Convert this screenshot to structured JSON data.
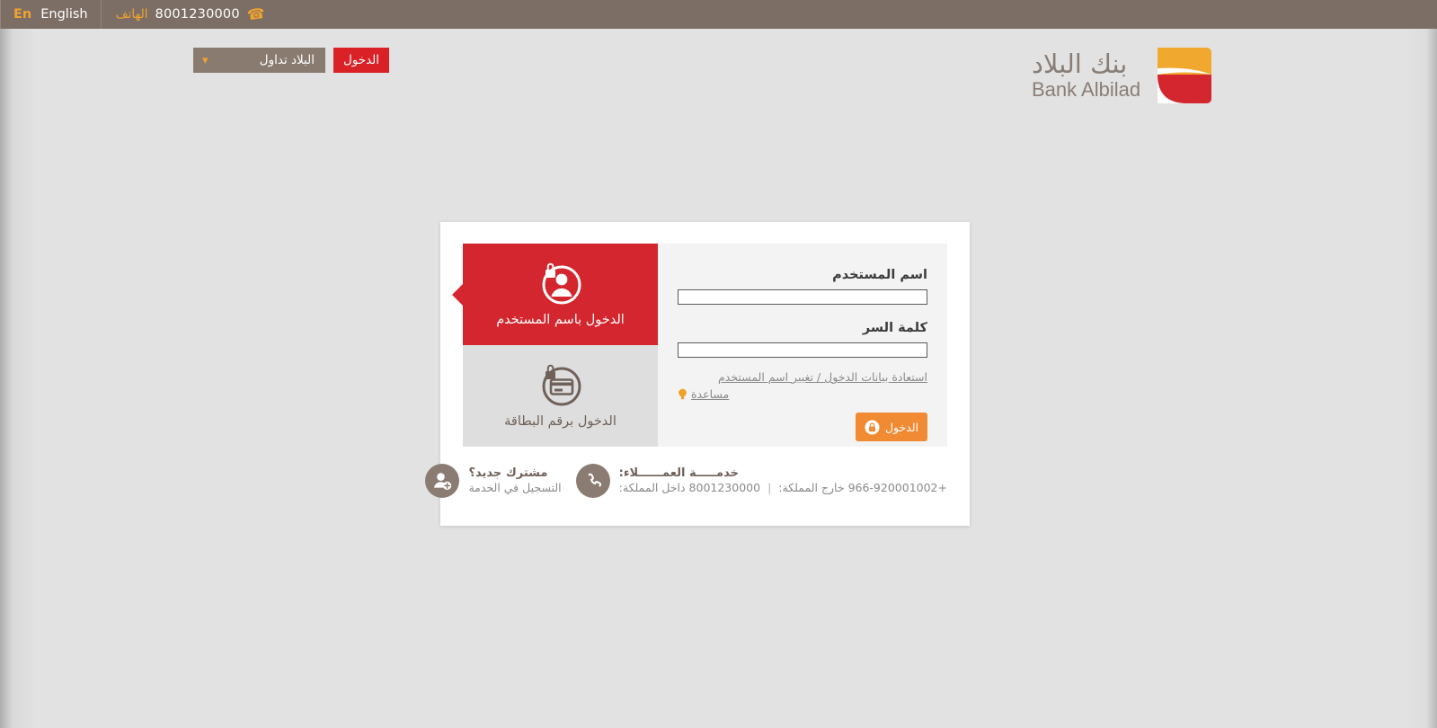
{
  "topbar": {
    "phone_icon": "phone-icon",
    "phone_number": "8001230000",
    "phone_label": "الهاتف",
    "lang_word": "English",
    "lang_abbr": "En"
  },
  "nav": {
    "login_label": "الدخول",
    "tadawul_label": "البلاد تداول",
    "caret_icon": "chevron-down-icon"
  },
  "logo": {
    "arabic": "بنك البلاد",
    "english": "Bank Albilad",
    "mark_icon": "albilad-mark-icon",
    "mark_yellow": "#f0a82e",
    "mark_red": "#d4262e",
    "text_color": "#897e76"
  },
  "tabs": [
    {
      "label": "الدخول باسم المستخدم",
      "icon": "user-lock-icon",
      "active": true
    },
    {
      "label": "الدخول برقم البطاقة",
      "icon": "card-lock-icon",
      "active": false
    }
  ],
  "form": {
    "username_label": "اسم المستخدم",
    "username_value": "",
    "username_placeholder": "",
    "password_label": "كلمة السر",
    "password_value": "",
    "password_placeholder": "",
    "recover_link": "استعادة بيانات الدخول / تغيير اسم المستخدم",
    "help_link": "مساعدة",
    "help_icon": "lightbulb-icon",
    "submit_label": "الدخول",
    "submit_icon": "lock-icon"
  },
  "footer": {
    "new_user": {
      "icon": "add-user-icon",
      "title": "مشترك جديد؟",
      "subtitle": "التسجيل في الخدمة"
    },
    "support": {
      "icon": "phone-icon",
      "title": "خدمـــــة العمــــــلاء:",
      "inside_label": "داخل المملكة:",
      "inside_number": "8001230000",
      "separator": "|",
      "outside_label": "خارج المملكة:",
      "outside_number": "+966-920001002"
    }
  },
  "colors": {
    "topbar": "#7c6e65",
    "brand_red": "#d4262e",
    "brand_orange": "#f08a33",
    "accent_gold": "#f0a22e",
    "page_bg": "#e2e2e2",
    "panel_bg": "#f3f3f3",
    "tab_inactive": "#dedede",
    "brown_text": "#6f6159"
  }
}
